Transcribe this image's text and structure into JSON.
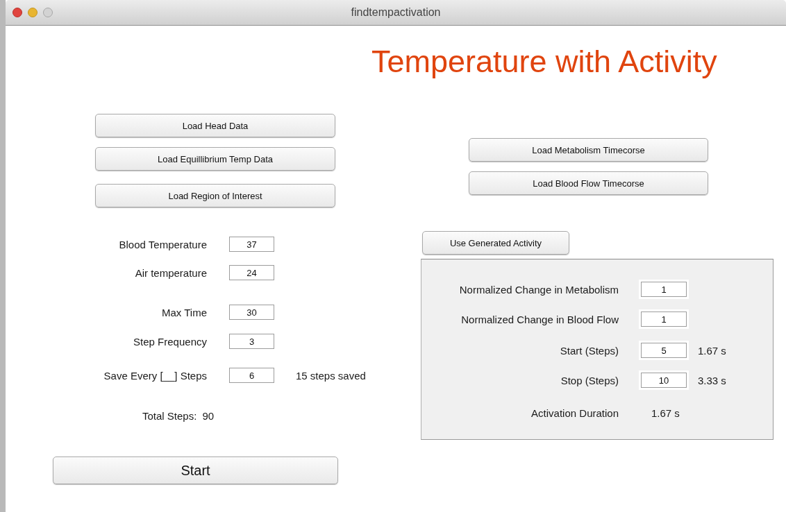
{
  "window": {
    "title": "findtempactivation"
  },
  "heading": "Temperature with Activity",
  "load_buttons": [
    "Load Head Data",
    "Load Equillibrium Temp Data",
    "Load Region of Interest"
  ],
  "parameters": [
    {
      "label": "Blood Temperature",
      "value": "37"
    },
    {
      "label": "Air temperature",
      "value": "24"
    },
    {
      "label": "Max Time",
      "value": "30"
    },
    {
      "label": "Step Frequency",
      "value": "3"
    },
    {
      "label": "Save Every [__] Steps",
      "value": "6",
      "note": "15 steps saved"
    }
  ],
  "total_steps": {
    "label": "Total Steps:",
    "value": "90"
  },
  "start_button": "Start",
  "timecourse_buttons": [
    "Load Metabolism Timecorse",
    "Load Blood Flow Timecorse"
  ],
  "activity_button": "Use Generated Activity",
  "activity_panel": {
    "fields": [
      {
        "label": "Normalized Change in Metabolism",
        "value": "1"
      },
      {
        "label": "Normalized Change in Blood Flow",
        "value": "1"
      },
      {
        "label": "Start (Steps)",
        "value": "5",
        "note": "1.67 s"
      },
      {
        "label": "Stop (Steps)",
        "value": "10",
        "note": "3.33 s"
      }
    ],
    "duration": {
      "label": "Activation Duration",
      "value": "1.67 s"
    }
  }
}
